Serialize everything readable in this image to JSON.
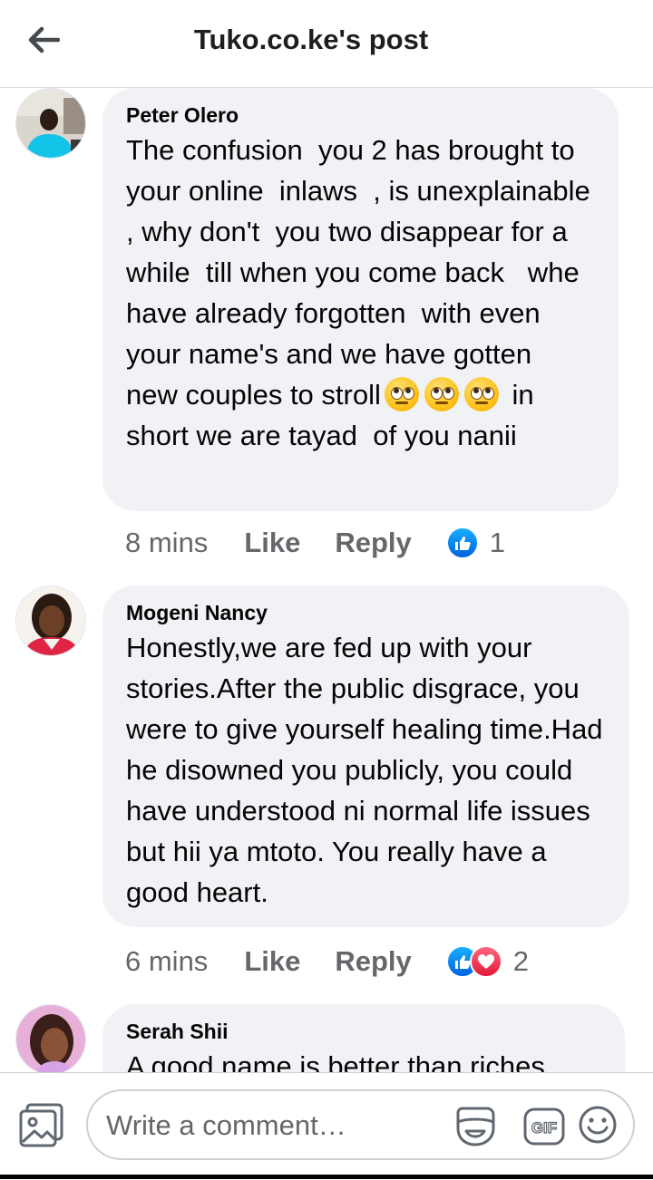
{
  "header": {
    "title": "Tuko.co.ke's post"
  },
  "comments": [
    {
      "author": "Peter Olero",
      "text_before": "The confusion  you 2 has brought to  your online  inlaws  , is unexplainable  , why don't  you two disappear for a while  till when you come back   whe have already forgotten  with even your name's and we have gotten  new couples to stroll",
      "emojis": [
        "face-with-rolling-eyes",
        "face-with-rolling-eyes",
        "face-with-rolling-eyes"
      ],
      "text_after": " in short we are tayad  of you nanii",
      "time": "8 mins",
      "like_label": "Like",
      "reply_label": "Reply",
      "reactions": [
        "like"
      ],
      "reaction_count": "1"
    },
    {
      "author": "Mogeni Nancy",
      "text": "Honestly,we are fed up with your stories.After the public disgrace, you were to give yourself healing time.Had he disowned you publicly, you could have understood ni normal life issues but hii ya mtoto. You really have a good heart.",
      "time": "6 mins",
      "like_label": "Like",
      "reply_label": "Reply",
      "reactions": [
        "like",
        "love"
      ],
      "reaction_count": "2"
    },
    {
      "author": "Serah Shii",
      "text": "A good name is better than riches"
    }
  ],
  "composer": {
    "placeholder": "Write a comment…",
    "icons": [
      "photo-icon",
      "sticker-icon",
      "gif-icon",
      "emoji-icon"
    ],
    "gif_label": "GIF"
  },
  "colors": {
    "bubble": "#f0f2f5",
    "muted_text": "#65676b",
    "like_blue": "#1877f2",
    "love_red": "#f33e58"
  }
}
